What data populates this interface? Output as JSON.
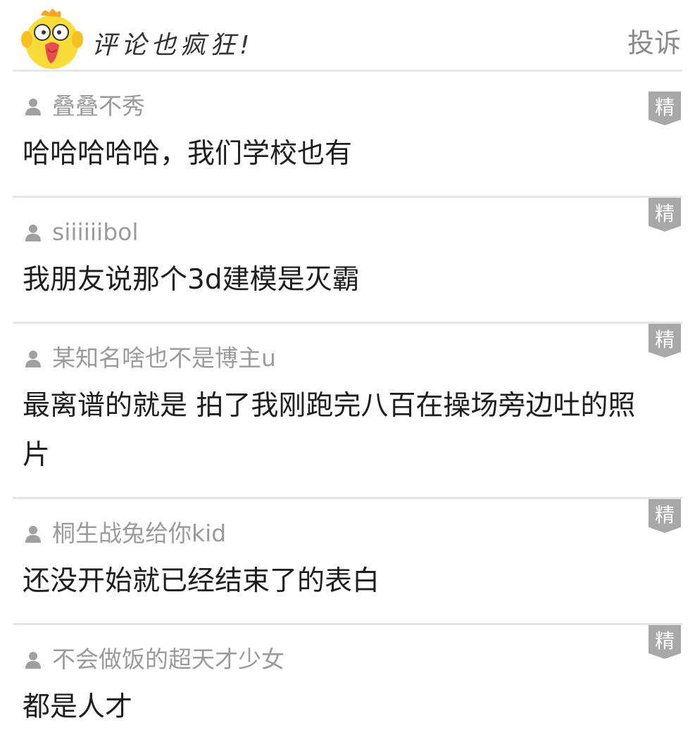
{
  "header": {
    "title": "评论也疯狂!",
    "report_label": "投诉",
    "mascot_icon": "yellow-chick-mascot-icon"
  },
  "badge_label": "精",
  "colors": {
    "username": "#9b9b9b",
    "text": "#1e1e1e",
    "divider": "#e5e5e5",
    "badge": "#a8a8a8",
    "report": "#8a8a8a"
  },
  "comments": [
    {
      "username": "叠叠不秀",
      "text": "哈哈哈哈哈，我们学校也有"
    },
    {
      "username": "siiiiiibol",
      "text": "我朋友说那个3d建模是灭霸"
    },
    {
      "username": "某知名啥也不是博主u",
      "text": "最离谱的就是 拍了我刚跑完八百在操场旁边吐的照片"
    },
    {
      "username": "桐生战兔给你kid",
      "text": "还没开始就已经结束了的表白"
    },
    {
      "username": "不会做饭的超天才少女",
      "text": "都是人才"
    }
  ]
}
